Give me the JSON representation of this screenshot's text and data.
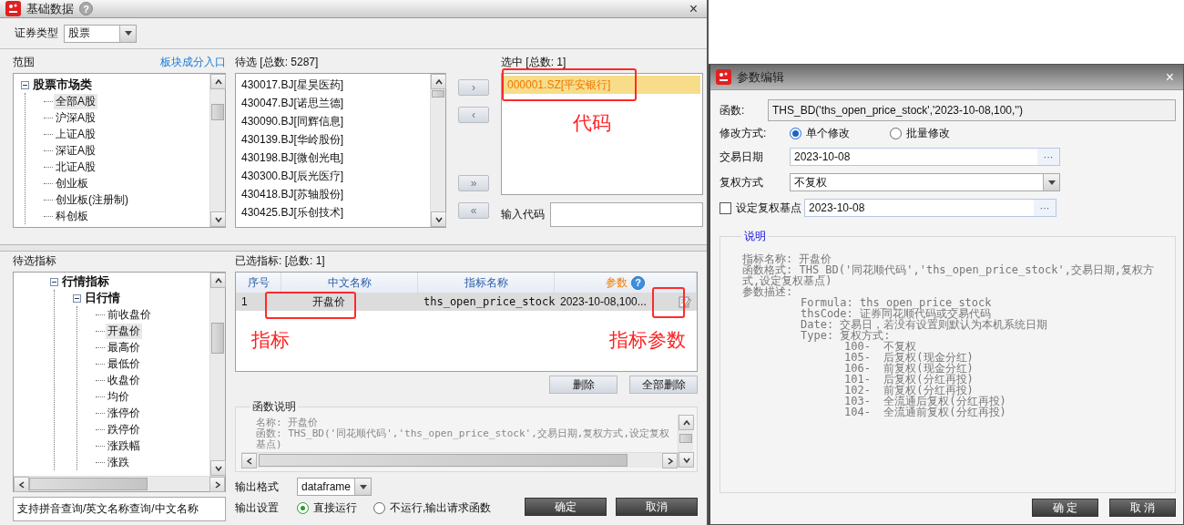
{
  "main_window": {
    "title": "基础数据",
    "help": "?",
    "close": "×"
  },
  "security_type": {
    "label": "证券类型",
    "value": "股票"
  },
  "scope": {
    "label": "范围",
    "link": "板块成分入口",
    "tree": [
      {
        "label": "股票市场类",
        "expanded": true,
        "selected": false,
        "children": [
          {
            "label": "全部A股",
            "selected": true
          },
          {
            "label": "沪深A股",
            "selected": false
          },
          {
            "label": "上证A股",
            "selected": false
          },
          {
            "label": "深证A股",
            "selected": false
          },
          {
            "label": "北证A股",
            "selected": false
          },
          {
            "label": "创业板",
            "selected": false
          },
          {
            "label": "创业板(注册制)",
            "selected": false
          },
          {
            "label": "科创板",
            "selected": false
          }
        ]
      }
    ]
  },
  "candidates": {
    "label": "待选 [总数: 5287]",
    "items": [
      "430017.BJ[星昊医药]",
      "430047.BJ[诺思兰德]",
      "430090.BJ[同辉信息]",
      "430139.BJ[华岭股份]",
      "430198.BJ[微创光电]",
      "430300.BJ[辰光医疗]",
      "430418.BJ[苏轴股份]",
      "430425.BJ[乐创技术]"
    ]
  },
  "transfer_buttons": [
    "›",
    "‹",
    "»",
    "«"
  ],
  "chosen": {
    "label": "选中 [总数: 1]",
    "items": [
      {
        "label": "000001.SZ[平安银行]",
        "selected": true
      }
    ],
    "annotation": "代码",
    "code_input_label": "输入代码"
  },
  "indicator_tree": {
    "label": "待选指标",
    "tree": [
      {
        "label": "行情指标",
        "expanded": true,
        "selected": false,
        "children": [
          {
            "label": "日行情",
            "expanded": true,
            "selected": false,
            "children": [
              {
                "label": "前收盘价",
                "selected": false
              },
              {
                "label": "开盘价",
                "selected": true
              },
              {
                "label": "最高价",
                "selected": false
              },
              {
                "label": "最低价",
                "selected": false
              },
              {
                "label": "收盘价",
                "selected": false
              },
              {
                "label": "均价",
                "selected": false
              },
              {
                "label": "涨停价",
                "selected": false
              },
              {
                "label": "跌停价",
                "selected": false
              },
              {
                "label": "涨跌幅",
                "selected": false
              },
              {
                "label": "涨跌",
                "selected": false
              }
            ]
          }
        ]
      }
    ]
  },
  "search": {
    "value": "支持拼音查询/英文名称查询/中文名称"
  },
  "selected_indicators": {
    "label": "已选指标: [总数: 1]",
    "columns": [
      "序号",
      "中文名称",
      "指标名称",
      "参数"
    ],
    "params_help": "?",
    "rows": [
      {
        "cells": [
          "1",
          "开盘价",
          "ths_open_price_stock",
          "2023-10-08,100..."
        ],
        "selected": true
      }
    ],
    "annotations": [
      "指标",
      "指标参数"
    ]
  },
  "row_buttons": [
    "删除",
    "全部删除"
  ],
  "function_description": {
    "title": "函数说明",
    "lines": [
      "名称: 开盘价",
      "函数: THS_BD('同花顺代码','ths_open_price_stock',交易日期,复权方式,设定复权基点)"
    ]
  },
  "output_format": {
    "label": "输出格式",
    "value": "dataframe"
  },
  "output_settings": {
    "label": "输出设置",
    "options": [
      {
        "label": "直接运行",
        "selected": true
      },
      {
        "label": "不运行,输出请求函数",
        "selected": false
      }
    ]
  },
  "dialog_buttons": [
    "确定",
    "取消"
  ],
  "param_dialog": {
    "title": "参数编辑",
    "close": "×",
    "function": {
      "label": "函数:",
      "value": "THS_BD('ths_open_price_stock','2023-10-08,100,'')"
    },
    "modify_mode": {
      "label": "修改方式:",
      "options": [
        {
          "label": "单个修改",
          "selected": true
        },
        {
          "label": "批量修改",
          "selected": false
        }
      ]
    },
    "trade_date": {
      "label": "交易日期",
      "value": "2023-10-08",
      "button": "···"
    },
    "adjust_mode": {
      "label": "复权方式",
      "value": "不复权"
    },
    "base_point": {
      "label": "设定复权基点",
      "checked": false,
      "value": "2023-10-08",
      "button": "···"
    },
    "notes": {
      "title": "说明",
      "lines": [
        {
          "text": "指标名称: 开盘价"
        },
        {
          "text": "函数格式: THS_BD('同花顺代码','ths_open_price_stock',交易日期,复权方式,设定复权基点)"
        },
        {
          "text": "参数描述:",
          "children": [
            {
              "text": "Formula: ths_open_price_stock"
            },
            {
              "text": "thsCode: 证券同花顺代码或交易代码"
            },
            {
              "text": "Date: 交易日，若没有设置则默认为本机系统日期"
            },
            {
              "text": "Type: 复权方式:",
              "children": [
                {
                  "text": "100-  不复权"
                },
                {
                  "text": "105-  后复权(现金分红)"
                },
                {
                  "text": "106-  前复权(现金分红)"
                },
                {
                  "text": "101-  后复权(分红再投)"
                },
                {
                  "text": "102-  前复权(分红再投)"
                },
                {
                  "text": "103-  全流通后复权(分红再投)"
                },
                {
                  "text": "104-  全流通前复权(分红再投)"
                }
              ]
            }
          ]
        }
      ]
    },
    "buttons": [
      "确 定",
      "取 消"
    ]
  }
}
